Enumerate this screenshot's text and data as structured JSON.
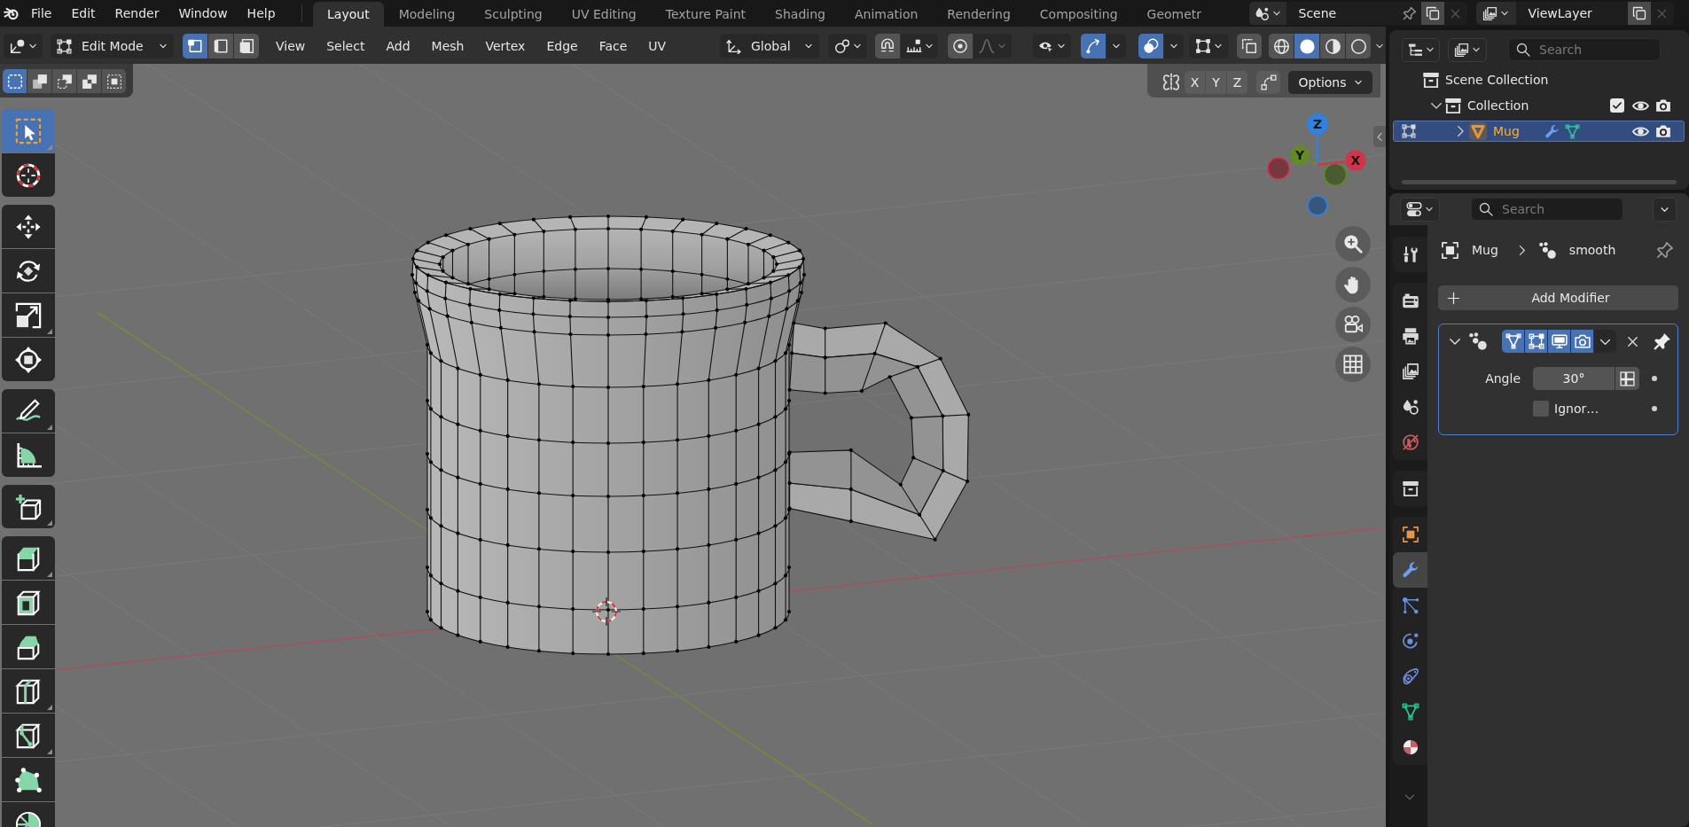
{
  "top_bar": {
    "menus": [
      "File",
      "Edit",
      "Render",
      "Window",
      "Help"
    ],
    "workspaces": [
      {
        "label": "Layout",
        "selected": true
      },
      {
        "label": "Modeling",
        "selected": false
      },
      {
        "label": "Sculpting",
        "selected": false
      },
      {
        "label": "UV Editing",
        "selected": false
      },
      {
        "label": "Texture Paint",
        "selected": false
      },
      {
        "label": "Shading",
        "selected": false
      },
      {
        "label": "Animation",
        "selected": false
      },
      {
        "label": "Rendering",
        "selected": false
      },
      {
        "label": "Compositing",
        "selected": false
      },
      {
        "label": "Geometr",
        "selected": false
      }
    ],
    "scene": "Scene",
    "view_layer": "ViewLayer"
  },
  "viewport_header": {
    "mode": "Edit Mode",
    "select_modes": [
      {
        "kind": "vertex",
        "selected": true
      },
      {
        "kind": "edge",
        "selected": false
      },
      {
        "kind": "face",
        "selected": false
      }
    ],
    "menus": [
      "View",
      "Select",
      "Add",
      "Mesh",
      "Vertex",
      "Edge",
      "Face",
      "UV"
    ],
    "orientation": "Global",
    "snapping": {
      "on": false
    },
    "proportional_editing": {
      "on": false
    },
    "gizmos": {
      "on": true
    },
    "overlays": {
      "on": true
    },
    "xray": {
      "on": false
    },
    "shading": [
      {
        "kind": "wireframe",
        "selected": false
      },
      {
        "kind": "solid",
        "selected": true
      },
      {
        "kind": "material",
        "selected": false
      },
      {
        "kind": "rendered",
        "selected": false
      }
    ]
  },
  "tool_header": {
    "select_box_modes": [
      {
        "kind": "set",
        "selected": true
      },
      {
        "kind": "extend",
        "selected": false
      },
      {
        "kind": "subtract",
        "selected": false
      },
      {
        "kind": "difference",
        "selected": false
      },
      {
        "kind": "intersect",
        "selected": false
      }
    ],
    "mirror_axes": [
      {
        "label": "X",
        "on": false
      },
      {
        "label": "Y",
        "on": false
      },
      {
        "label": "Z",
        "on": false
      }
    ],
    "auto_merge": {
      "on": false
    },
    "options": "Options"
  },
  "toolbar": {
    "groups": [
      [
        {
          "kind": "select_box",
          "selected": true,
          "more": true
        },
        {
          "kind": "cursor",
          "selected": false,
          "more": false
        }
      ],
      [
        {
          "kind": "move",
          "selected": false,
          "more": false
        },
        {
          "kind": "rotate",
          "selected": false,
          "more": false
        },
        {
          "kind": "scale",
          "selected": false,
          "more": true
        },
        {
          "kind": "transform",
          "selected": false,
          "more": false
        }
      ],
      [
        {
          "kind": "annotate",
          "selected": false,
          "more": true
        },
        {
          "kind": "measure",
          "selected": false,
          "more": false
        }
      ],
      [
        {
          "kind": "add_cube",
          "selected": false,
          "more": true
        }
      ],
      [
        {
          "kind": "extrude",
          "selected": false,
          "more": true
        },
        {
          "kind": "inset",
          "selected": false,
          "more": false
        },
        {
          "kind": "bevel",
          "selected": false,
          "more": false
        },
        {
          "kind": "loop_cut",
          "selected": false,
          "more": true
        },
        {
          "kind": "knife",
          "selected": false,
          "more": true
        },
        {
          "kind": "poly_build",
          "selected": false,
          "more": false
        },
        {
          "kind": "spin",
          "selected": false,
          "more": false
        }
      ]
    ]
  },
  "view_gizmo": {
    "axes": [
      {
        "label": "Z",
        "color": "#2f82e2"
      },
      {
        "label": "Y",
        "color": "#628c23"
      },
      {
        "label": "X",
        "color": "#d2334b"
      }
    ]
  },
  "outliner": {
    "search": {
      "placeholder": "Search"
    },
    "tree": [
      {
        "kind": "scene_collection",
        "label": "Scene Collection",
        "selected": false,
        "children": [
          {
            "kind": "collection",
            "label": "Collection",
            "selected": false,
            "expanded": true,
            "checked": true,
            "visible": true,
            "renderable": true,
            "children": [
              {
                "kind": "mesh_object",
                "label": "Mug",
                "selected": true,
                "expanded": false,
                "visible": true,
                "renderable": true
              }
            ]
          }
        ]
      }
    ]
  },
  "properties": {
    "search": {
      "placeholder": "Search"
    },
    "tab_groups": [
      [
        {
          "kind": "tool",
          "selected": false
        }
      ],
      [
        {
          "kind": "render",
          "selected": false
        },
        {
          "kind": "output",
          "selected": false
        },
        {
          "kind": "view_layer",
          "selected": false
        },
        {
          "kind": "scene",
          "selected": false
        },
        {
          "kind": "world",
          "selected": false
        }
      ],
      [
        {
          "kind": "collection",
          "selected": false
        }
      ],
      [
        {
          "kind": "object",
          "selected": false
        },
        {
          "kind": "modifier",
          "selected": true
        },
        {
          "kind": "particles",
          "selected": false
        },
        {
          "kind": "physics",
          "selected": false
        },
        {
          "kind": "constraints",
          "selected": false
        },
        {
          "kind": "data",
          "selected": false
        },
        {
          "kind": "material",
          "selected": false
        }
      ]
    ],
    "breadcrumb": [
      {
        "kind": "object",
        "label": "Mug"
      },
      {
        "kind": "modifier",
        "label": "smooth"
      }
    ],
    "add_modifier": "Add Modifier",
    "modifier": {
      "expanded": true,
      "toggles": [
        {
          "kind": "edit_mode",
          "on": true
        },
        {
          "kind": "on_cage",
          "on": true
        },
        {
          "kind": "viewport",
          "on": true
        },
        {
          "kind": "render",
          "on": true
        }
      ],
      "fields": [
        {
          "kind": "number",
          "label": "Angle",
          "value": "30°"
        },
        {
          "kind": "checkbox",
          "label": "Ignor…",
          "checked": false
        }
      ]
    }
  }
}
